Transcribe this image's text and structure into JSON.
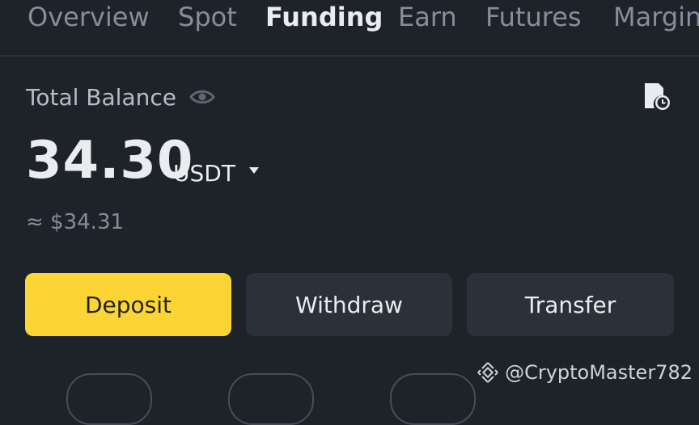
{
  "tabs": [
    {
      "label": "Overview",
      "active": false
    },
    {
      "label": "Spot",
      "active": false
    },
    {
      "label": "Funding",
      "active": true
    },
    {
      "label": "Earn",
      "active": false
    },
    {
      "label": "Futures",
      "active": false
    },
    {
      "label": "Margin",
      "active": false
    }
  ],
  "balance": {
    "label": "Total Balance",
    "amount": "34.30",
    "currency": "USDT",
    "approx": "≈ $34.31"
  },
  "actions": {
    "deposit": "Deposit",
    "withdraw": "Withdraw",
    "transfer": "Transfer"
  },
  "watermark": "@CryptoMaster782",
  "icons": {
    "visibility": "eye-icon",
    "history": "history-icon",
    "currency_dropdown": "caret-down-icon",
    "watermark_logo": "binance-logo-icon"
  },
  "colors": {
    "background": "#1e2329",
    "accent": "#fcd535",
    "button_secondary": "#2b3139",
    "text_primary": "#eaecef",
    "text_muted": "#848e9c"
  }
}
